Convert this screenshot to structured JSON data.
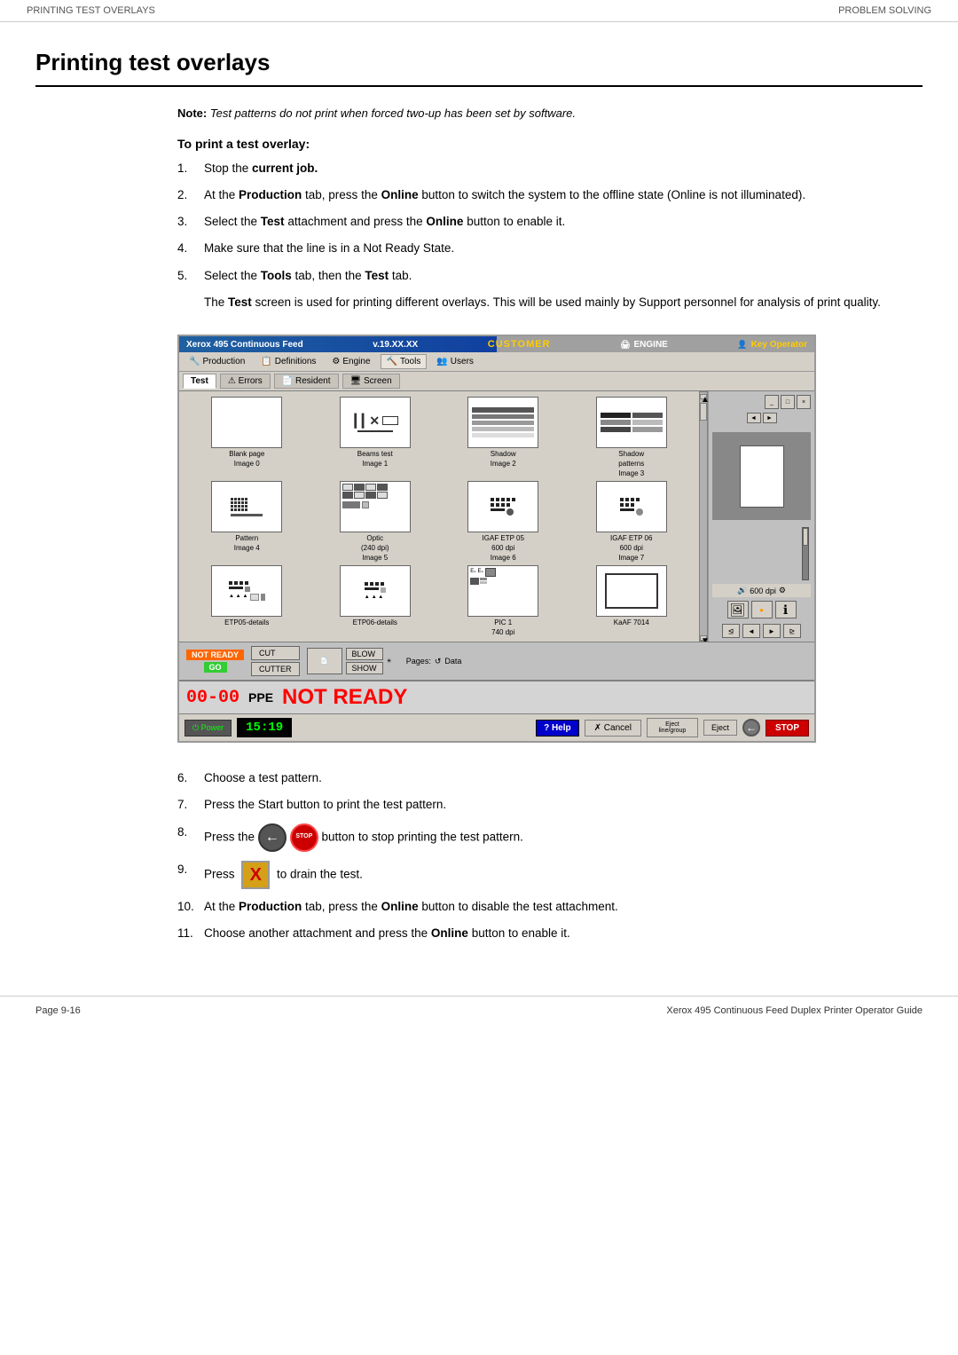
{
  "header": {
    "left": "PRINTING TEST OVERLAYS",
    "right": "PROBLEM SOLVING"
  },
  "page_title": "Printing test overlays",
  "note": {
    "label": "Note:",
    "text": "Test patterns do not print when forced two-up has been set by software."
  },
  "to_print_heading": "To print a test overlay:",
  "steps": [
    {
      "id": 1,
      "text": "Stop the <strong>current job.</strong>"
    },
    {
      "id": 2,
      "text": "At the <strong>Production</strong> tab, press the <strong>Online</strong> button to switch the system to the offline state (Online is not illuminated)."
    },
    {
      "id": 3,
      "text": "Select the <strong>Test</strong> attachment and press the <strong>Online</strong> button to enable it."
    },
    {
      "id": 4,
      "text": "Make sure that the line is in a Not Ready State."
    },
    {
      "id": 5,
      "text": "Select the <strong>Tools</strong> tab, then the <strong>Test</strong> tab."
    },
    {
      "id": 5,
      "subtext": "The <strong>Test</strong> screen is used for printing different overlays. This will be used mainly by Support personnel for analysis of print quality."
    }
  ],
  "steps_after": [
    {
      "id": 6,
      "text": "Choose a test pattern."
    },
    {
      "id": 7,
      "text": "Press the Start button to print the test pattern."
    },
    {
      "id": 8,
      "text": "Press the",
      "suffix": "button to stop printing the test pattern."
    },
    {
      "id": 9,
      "text": "Press",
      "suffix": "to drain the test."
    },
    {
      "id": 10,
      "text": "At the <strong>Production</strong> tab, press the <strong>Online</strong> button to disable the test attachment."
    },
    {
      "id": 11,
      "text": "Choose another attachment and press the <strong>Online</strong> button to enable it."
    }
  ],
  "ui": {
    "title_bar": {
      "left": "Xerox  495 Continuous Feed",
      "version": "v.19.XX.XX",
      "customer_label": "CUSTOMER",
      "engine_label": "ENGINE",
      "operator_label": "Key Operator"
    },
    "menu": {
      "items": [
        "Production",
        "Definitions",
        "Engine",
        "Tools",
        "Users"
      ]
    },
    "tabs": {
      "items": [
        "Test",
        "Errors",
        "Resident",
        "Screen"
      ]
    },
    "images": [
      {
        "label": "Blank page",
        "sublabel": "Image 0",
        "type": "blank"
      },
      {
        "label": "Beams test",
        "sublabel": "Image 1",
        "type": "beams"
      },
      {
        "label": "Shadow",
        "sublabel": "Image 2",
        "type": "shadow"
      },
      {
        "label": "Shadow patterns",
        "sublabel": "Image 3",
        "type": "shadow_pat"
      },
      {
        "label": "Pattern",
        "sublabel": "Image 4",
        "type": "pattern"
      },
      {
        "label": "Optic (240 dpi)",
        "sublabel": "Image 5",
        "type": "optic"
      },
      {
        "label": "IGAF ETP 05 600 dpi",
        "sublabel": "Image 6",
        "type": "dots"
      },
      {
        "label": "IGAF ETP 06 600 dpi",
        "sublabel": "Image 7",
        "type": "dots2"
      },
      {
        "label": "ETP05-details",
        "sublabel": "",
        "type": "etp05"
      },
      {
        "label": "ETP06-details",
        "sublabel": "",
        "type": "etp06"
      },
      {
        "label": "PIC 1 740 dpi",
        "sublabel": "",
        "type": "pic1"
      },
      {
        "label": "KaAF 7014",
        "sublabel": "",
        "type": "kaaf"
      }
    ],
    "bottom_bar": {
      "not_ready": "NOT READY",
      "go": "GO",
      "cut": "CUT",
      "cutter": "CUTTER",
      "blow": "BLOW",
      "show": "SHOW",
      "pages_label": "Pages:",
      "data_label": "Data"
    },
    "status_bar": {
      "ppe": "00-00",
      "ppe_label": "PPE",
      "not_ready": "NOT READY"
    },
    "footer_bar": {
      "power": "Power",
      "time": "15:19",
      "help": "Help",
      "cancel": "Cancel",
      "eject": "Eject line/group",
      "eject2": "Eject",
      "stop": "STOP"
    },
    "dpi": "600 dpi"
  },
  "footer": {
    "left": "Page 9-16",
    "right": "Xerox 495 Continuous Feed Duplex Printer Operator Guide"
  }
}
